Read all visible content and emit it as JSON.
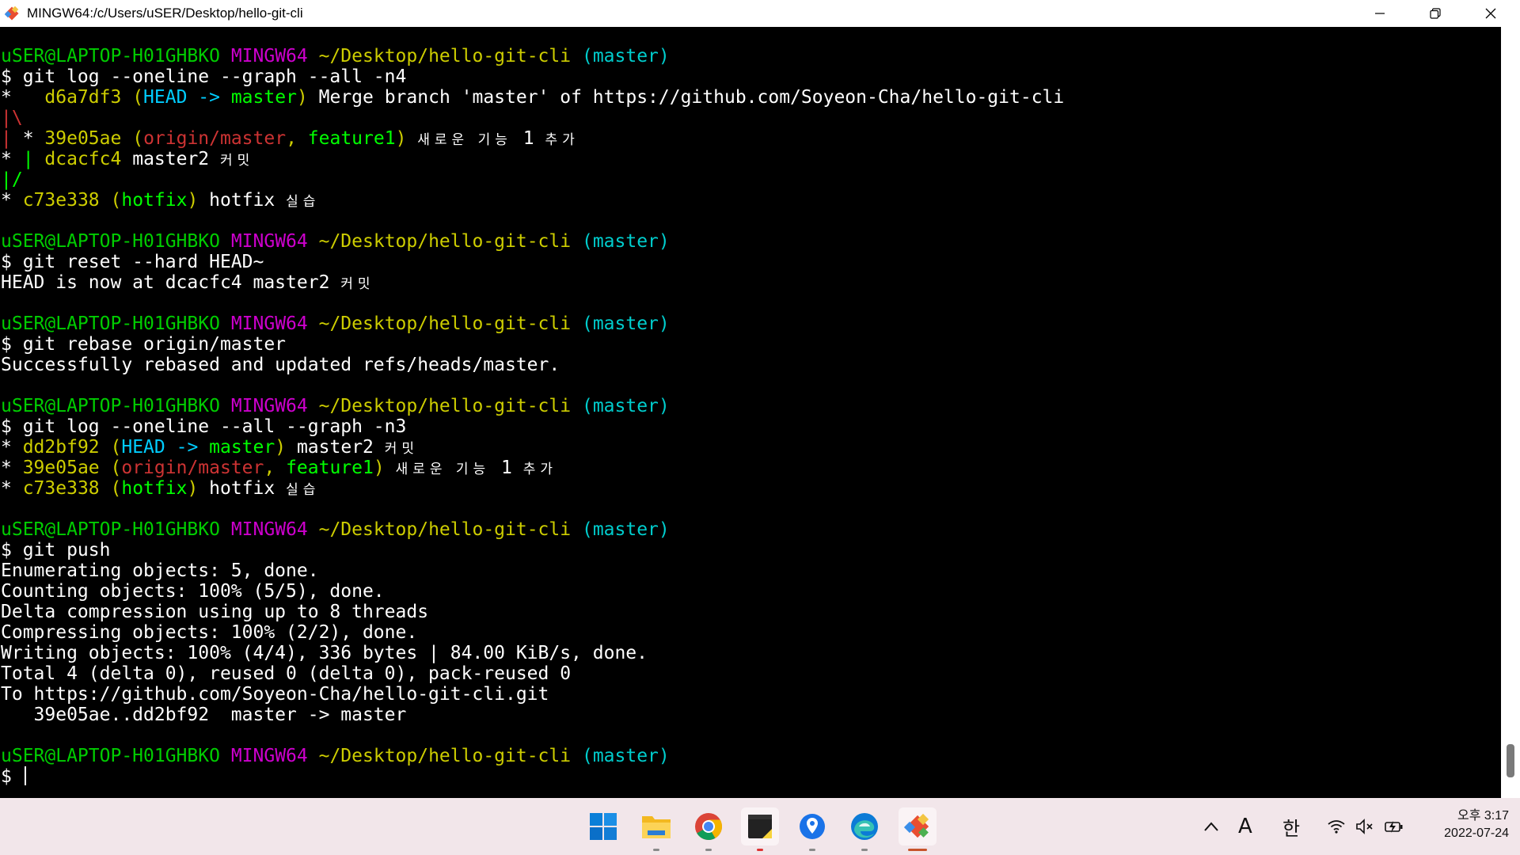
{
  "window": {
    "title": "MINGW64:/c/Users/uSER/Desktop/hello-git-cli"
  },
  "prompt": {
    "user": "uSER@LAPTOP-H01GHBKO",
    "system": "MINGW64",
    "path": "~/Desktop/hello-git-cli",
    "branch": "(master)"
  },
  "terminal": {
    "cmd1": "$ git log --oneline --graph --all -n4",
    "log1": {
      "l1_marker": "*   ",
      "l1_hash": "d6a7df3",
      "l1_head": "HEAD -> ",
      "l1_branch": "master",
      "l1_msg": " Merge branch 'master' of https://github.com/Soyeon-Cha/hello-git-cli",
      "l2_graph": "|\\",
      "l3_marker": " * ",
      "l3_hash": "39e05ae",
      "l3_origin": "origin/master",
      "l3_feature": "feature1",
      "l3_msg": "새로운 기능",
      "l3_num": "1",
      "l3_msg2": "추가",
      "l4_hash": "dcacfc4",
      "l4_msg": "master2",
      "l4_ko": "커밋",
      "l5_graph": "|/",
      "l6_hash": "c73e338",
      "l6_branch": "hotfix",
      "l6_msg": "hotfix",
      "l6_ko": "실습"
    },
    "cmd2": "$ git reset --hard HEAD~",
    "out2": "HEAD is now at dcacfc4 master2",
    "out2_ko": "커밋",
    "cmd3": "$ git rebase origin/master",
    "out3": "Successfully rebased and updated refs/heads/master.",
    "cmd4": "$ git log --oneline --all --graph -n3",
    "log2": {
      "l1_hash": "dd2bf92",
      "l1_head": "HEAD -> ",
      "l1_branch": "master",
      "l1_msg": "master2",
      "l1_ko": "커밋",
      "l2_hash": "39e05ae",
      "l2_origin": "origin/master",
      "l2_feature": "feature1",
      "l2_msg": "새로운 기능",
      "l2_num": "1",
      "l2_msg2": "추가",
      "l3_hash": "c73e338",
      "l3_branch": "hotfix",
      "l3_msg": "hotfix",
      "l3_ko": "실습"
    },
    "cmd5": "$ git push",
    "push": [
      "Enumerating objects: 5, done.",
      "Counting objects: 100% (5/5), done.",
      "Delta compression using up to 8 threads",
      "Compressing objects: 100% (2/2), done.",
      "Writing objects: 100% (4/4), 336 bytes | 84.00 KiB/s, done.",
      "Total 4 (delta 0), reused 0 (delta 0), pack-reused 0",
      "To https://github.com/Soyeon-Cha/hello-git-cli.git",
      "   39e05ae..dd2bf92  master -> master"
    ],
    "final_prompt": "$ "
  },
  "taskbar": {
    "apps": [
      "start-icon",
      "file-explorer-icon",
      "chrome-icon",
      "sticky-notes-icon",
      "maps-icon",
      "edge-icon",
      "git-bash-icon"
    ],
    "tray_chevron": "^",
    "ime_a": "A",
    "ime_ko": "한",
    "time": "오후 3:17",
    "date": "2022-07-24"
  },
  "colors": {
    "user": "#00cd00",
    "system": "#cd00cd",
    "path": "#cdcd00",
    "branch": "#00cdcd",
    "taskbar": "#f2e6ea"
  }
}
